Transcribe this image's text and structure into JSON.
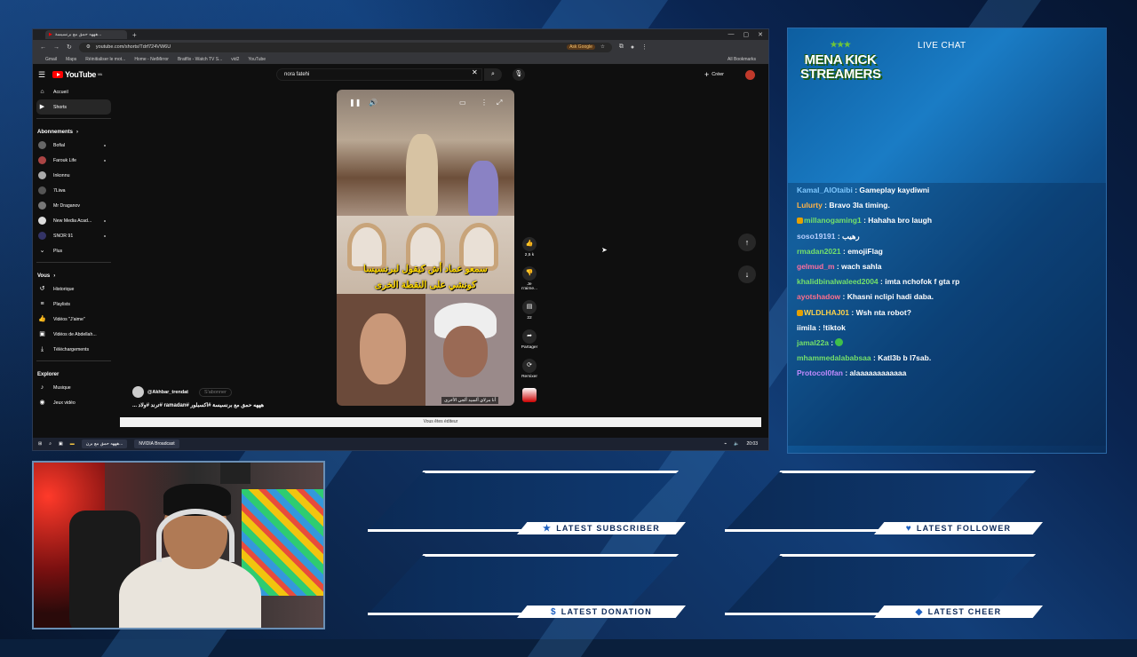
{
  "browser": {
    "tab_label": "هههه حمق مع برنسيسة...",
    "url": "youtube.com/shorts/Tdrf724VW6U",
    "ask_google": "Ask Google",
    "bookmarks": [
      "Gmail",
      "Maps",
      "Réinitialiser le mot...",
      "Home - NetMirror",
      "Bratflix - Watch TV S...",
      "vid2",
      "YouTube"
    ],
    "all_bookmarks": "All Bookmarks"
  },
  "youtube": {
    "logo": "YouTube",
    "logo_suffix": "MA",
    "search_value": "nora fatehi",
    "create_label": "Créer",
    "sidebar": {
      "main": [
        {
          "label": "Accueil",
          "icon": "home-icon"
        },
        {
          "label": "Shorts",
          "icon": "shorts-icon"
        }
      ],
      "subs_title": "Abonnements",
      "subs": [
        "Bofial",
        "Farouk Life",
        "Inkonnu",
        "7Liwa",
        "Mr Draganov",
        "New Media Acad...",
        "SNOR 91"
      ],
      "more": "Plus",
      "you_title": "Vous",
      "you": [
        {
          "label": "Historique",
          "icon": "history-icon"
        },
        {
          "label": "Playlists",
          "icon": "playlist-icon"
        },
        {
          "label": "Vidéos \"J'aime\"",
          "icon": "like-icon"
        },
        {
          "label": "Vidéos de Abdellah...",
          "icon": "video-icon"
        },
        {
          "label": "Téléchargements",
          "icon": "download-icon"
        }
      ],
      "explore_title": "Explorer",
      "explore": [
        {
          "label": "Musique",
          "icon": "music-icon"
        },
        {
          "label": "Jeux vidéo",
          "icon": "game-icon"
        }
      ]
    },
    "short": {
      "caption_line1": "سمعو عماد أش كيقول لبرنسيسا",
      "caption_line2": "كونشي على النقطة الخرى",
      "bottom_tag": "أنا مرلاي ألسيد ألجي الأخرى",
      "channel": "@Akhbar_trendat",
      "subscribe": "S'abonner",
      "title": "هههه حمق مع برنسيسة #اكسبلور #ramadan #ترند #ولاد ...",
      "actions": [
        {
          "icon": "like-icon",
          "label": "2,5 k"
        },
        {
          "icon": "dislike-icon",
          "label": "Je n'aime..."
        },
        {
          "icon": "comment-icon",
          "label": "22"
        },
        {
          "icon": "share-icon",
          "label": "Partager"
        },
        {
          "icon": "remix-icon",
          "label": "Remixer"
        }
      ]
    },
    "edit_bar": "Vous êtes éditeur"
  },
  "taskbar": {
    "items": [
      "هههه حمق مع برن...",
      "NVIDIA Broadcast"
    ],
    "time": "20:03"
  },
  "chat": {
    "logo_line1": "MENA KICK",
    "logo_line2": "STREAMERS",
    "title": "LIVE CHAT",
    "messages": [
      {
        "user": "Kamal_AlOtaibi",
        "color": "#7ec8ff",
        "text": "Gameplay kaydiwni",
        "badge": false
      },
      {
        "user": "Lulurty",
        "color": "#ffb347",
        "text": "Bravo 3la timing.",
        "badge": false
      },
      {
        "user": "millanogaming1",
        "color": "#74e06a",
        "text": "Hahaha bro laugh",
        "badge": true
      },
      {
        "user": "soso19191",
        "color": "#b9d0ff",
        "text": "رهيب",
        "badge": false
      },
      {
        "user": "rmadan2021",
        "color": "#74e06a",
        "text": "emojiFlag",
        "badge": false
      },
      {
        "user": "gelmud_m",
        "color": "#ff6fa0",
        "text": "wach sahla",
        "badge": false
      },
      {
        "user": "khalidbinalwaleed2004",
        "color": "#74e06a",
        "text": "imta nchofok f gta rp",
        "badge": false
      },
      {
        "user": "ayotshadow",
        "color": "#ff6f8c",
        "text": "Khasni nclipi hadi daba.",
        "badge": false
      },
      {
        "user": "WLDLHAJ01",
        "color": "#ffd24a",
        "text": "Wsh nta robot?",
        "badge": true
      },
      {
        "user": "iimila",
        "color": "#ffffff",
        "text": "!tiktok",
        "badge": false
      },
      {
        "user": "jamal22a",
        "color": "#74e06a",
        "text": "",
        "badge": false
      },
      {
        "user": "mhammedalababsaa",
        "color": "#74e06a",
        "text": "Katl3b b l7sab.",
        "badge": false
      },
      {
        "user": "Protocol0fan",
        "color": "#c38bff",
        "text": "alaaaaaaaaaaaa",
        "badge": false
      }
    ]
  },
  "latest": [
    {
      "label": "LATEST SUBSCRIBER",
      "icon": "star-icon"
    },
    {
      "label": "LATEST FOLLOWER",
      "icon": "heart-icon"
    },
    {
      "label": "LATEST DONATION",
      "icon": "dollar-icon"
    },
    {
      "label": "LATEST CHEER",
      "icon": "diamond-icon"
    }
  ]
}
